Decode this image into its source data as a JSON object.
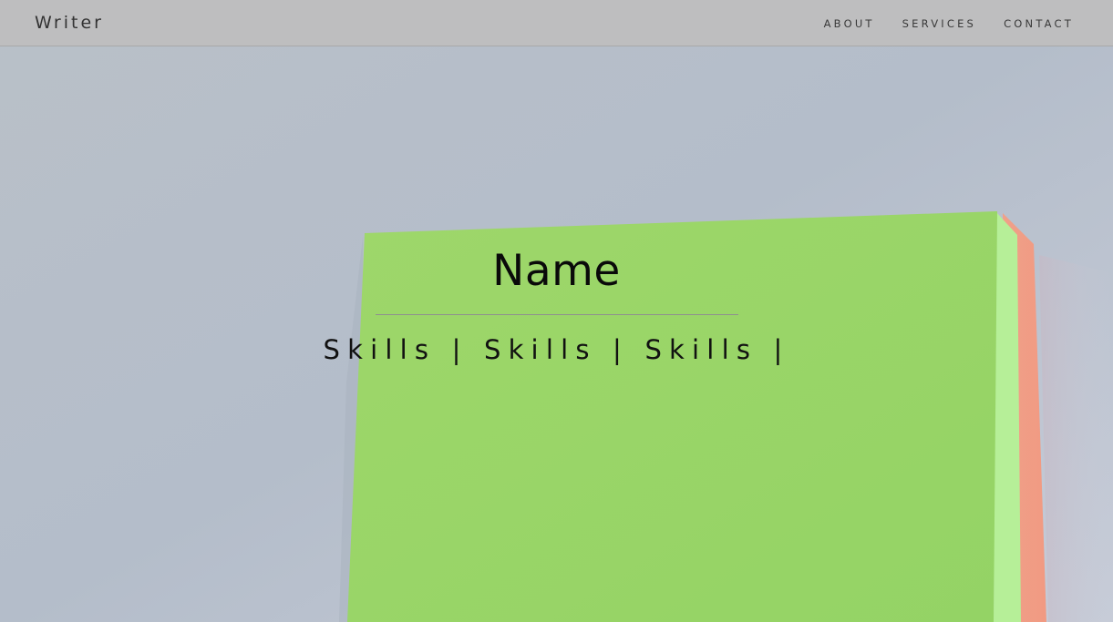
{
  "navbar": {
    "brand": "Writer",
    "links": [
      {
        "label": "ABOUT"
      },
      {
        "label": "SERVICES"
      },
      {
        "label": "CONTACT"
      }
    ]
  },
  "hero": {
    "name": "Name",
    "skills": "Skills | Skills | Skills |"
  },
  "colors": {
    "navbar_bg": "#bebebe",
    "wall": "#b8c0cc",
    "sticky_note_green": "#9ad766",
    "sticky_note_edge": "#b6ef98",
    "sticky_note_side": "#f29a80",
    "text_dark": "#0a0a0a"
  }
}
